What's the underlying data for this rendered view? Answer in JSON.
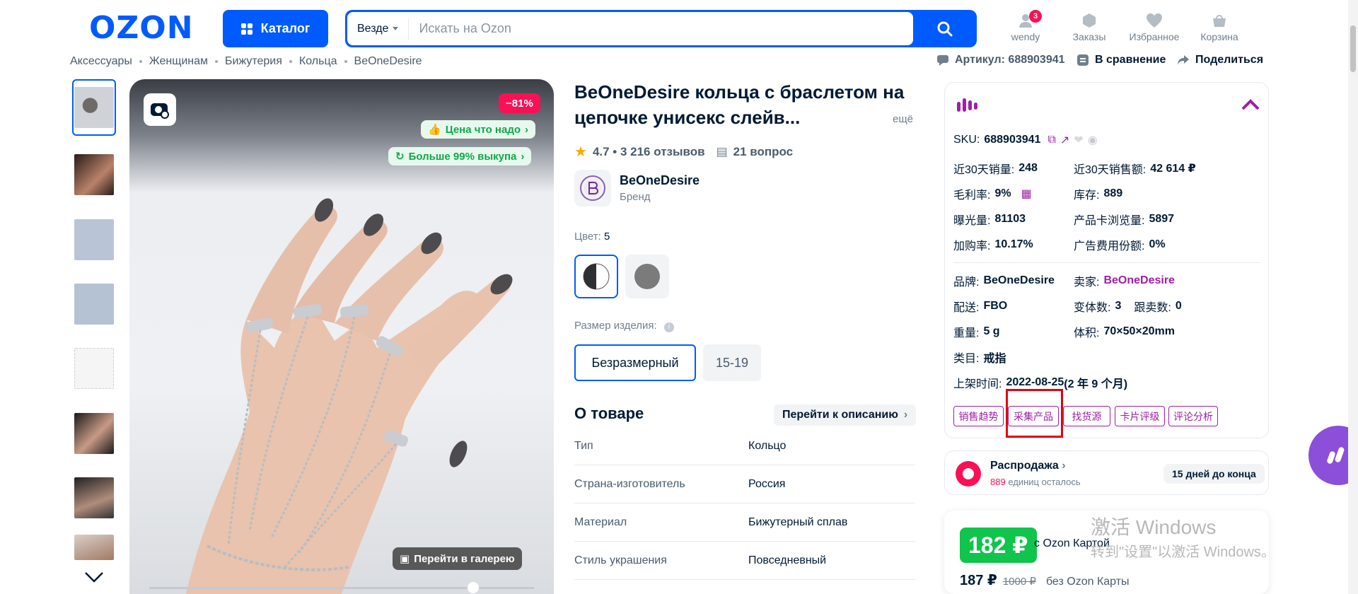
{
  "header": {
    "logo": "OZON",
    "catalog_label": "Каталог",
    "search_scope": "Везде",
    "search_placeholder": "Искать на Ozon",
    "user": {
      "label": "wendy",
      "badge": "3"
    },
    "orders_label": "Заказы",
    "favorites_label": "Избранное",
    "cart_label": "Корзина"
  },
  "breadcrumb": [
    "Аксессуары",
    "Женщинам",
    "Бижутерия",
    "Кольца",
    "BeOneDesire"
  ],
  "top_actions": {
    "article": "Артикул: 688903941",
    "compare": "В сравнение",
    "share": "Поделиться"
  },
  "gallery": {
    "discount": "−81%",
    "price_ok": "Цена что надо",
    "buyout": "Больше 99% выкупа",
    "go_gallery": "Перейти в галерею"
  },
  "product": {
    "title": "BeOneDesire кольца с браслетом на цепочке унисекс слейв...",
    "more": "ещё",
    "rating": "4.7 • 3 216 отзывов",
    "questions": "21 вопрос",
    "brand_name": "BeOneDesire",
    "brand_label": "Бренд",
    "color_label": "Цвет:",
    "color_value": "5",
    "size_label": "Размер изделия:",
    "sizes": [
      "Безразмерный",
      "15-19"
    ],
    "about_title": "О товаре",
    "desc_link": "Перейти к описанию",
    "specs": [
      {
        "k": "Тип",
        "v": "Кольцо"
      },
      {
        "k": "Страна-изготовитель",
        "v": "Россия"
      },
      {
        "k": "Материал",
        "v": "Бижутерный сплав"
      },
      {
        "k": "Стиль украшения",
        "v": "Повседневный"
      }
    ]
  },
  "panel": {
    "sku_label": "SKU:",
    "sku": "688903941",
    "sales30_label": "近30天销量:",
    "sales30": "248",
    "revenue30_label": "近30天销售额:",
    "revenue30": "42 614 ₽",
    "margin_label": "毛利率:",
    "margin": "9%",
    "stock_label": "库存:",
    "stock": "889",
    "views_label": "曝光量:",
    "views": "81103",
    "card_views_label": "产品卡浏览量:",
    "card_views": "5897",
    "cart_rate_label": "加购率:",
    "cart_rate": "10.17%",
    "ad_share_label": "广告费用份额:",
    "ad_share": "0%",
    "brand_label": "品牌:",
    "brand": "BeOneDesire",
    "seller_label": "卖家:",
    "seller": "BeOneDesire",
    "delivery_label": "配送:",
    "delivery": "FBO",
    "variants_label": "变体数:",
    "variants": "3",
    "followers_label": "跟卖数:",
    "followers": "0",
    "weight_label": "重量:",
    "weight": "5 g",
    "volume_label": "体积:",
    "volume": "70×50×20mm",
    "category_label": "类目:",
    "category": "戒指",
    "listed_label": "上架时间:",
    "listed_date": "2022-08-25",
    "listed_age": "(2 年 9 个月)",
    "tags": [
      "销售趋势",
      "采集产品",
      "找货源",
      "卡片评级",
      "评论分析"
    ]
  },
  "sale": {
    "title": "Распродажа",
    "left_count": "889",
    "left_text": "единиц осталось",
    "days": "15 дней до конца"
  },
  "price": {
    "card_price": "182 ₽",
    "card_label": "с Ozon Картой",
    "price": "187 ₽",
    "old_price": "1000 ₽",
    "no_card_label": "без Ozon Карты"
  },
  "watermark": {
    "line1": "激活 Windows",
    "line2": "转到\"设置\"以激活 Windows。"
  },
  "colors": {
    "ozon_blue": "#005bff",
    "accent_magenta": "#a01ea8",
    "sale_pink": "#f91155",
    "green": "#10c44c",
    "highlight_red": "#e60012"
  }
}
